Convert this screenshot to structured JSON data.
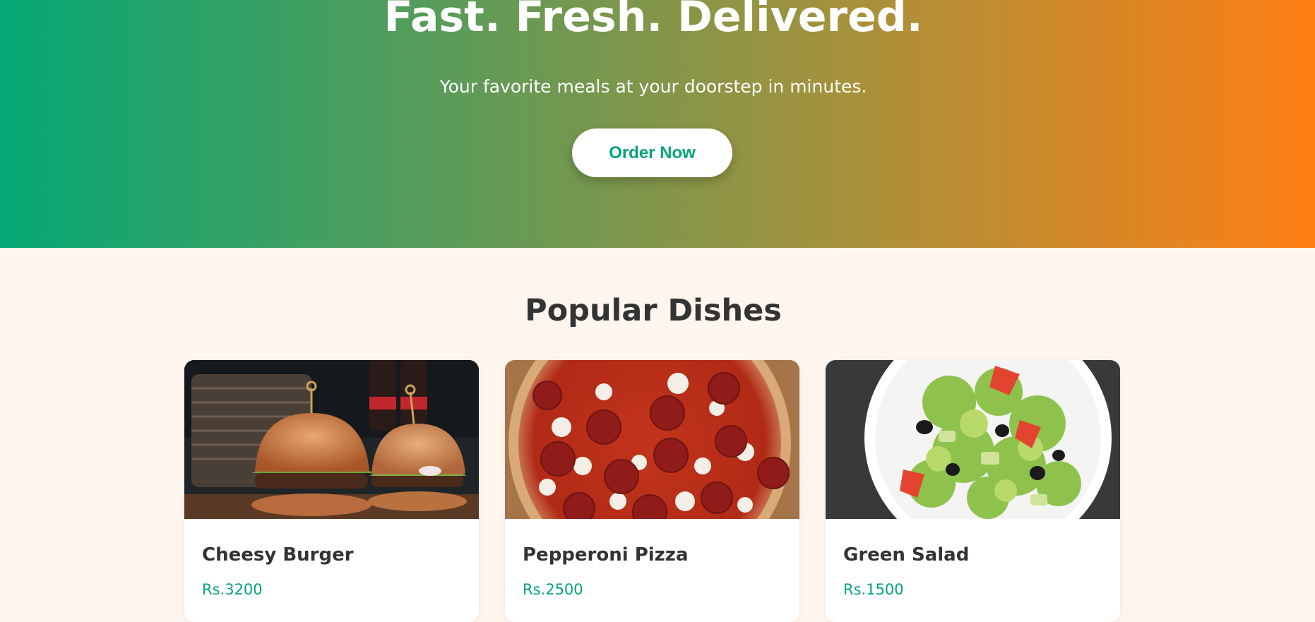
{
  "hero": {
    "title": "Fast. Fresh. Delivered.",
    "subtitle": "Your favorite meals at your doorstep in minutes.",
    "cta_label": "Order Now"
  },
  "popular": {
    "title": "Popular Dishes",
    "dishes": [
      {
        "name": "Cheesy Burger",
        "price": "Rs.3200",
        "image": "burger-photo"
      },
      {
        "name": "Pepperoni Pizza",
        "price": "Rs.2500",
        "image": "pizza-photo"
      },
      {
        "name": "Green Salad",
        "price": "Rs.1500",
        "image": "salad-photo"
      }
    ]
  },
  "colors": {
    "gradient_start": "#03a875",
    "gradient_end": "#ff7e14",
    "accent": "#05a477",
    "background": "#fdf5ee",
    "text": "#333333"
  }
}
